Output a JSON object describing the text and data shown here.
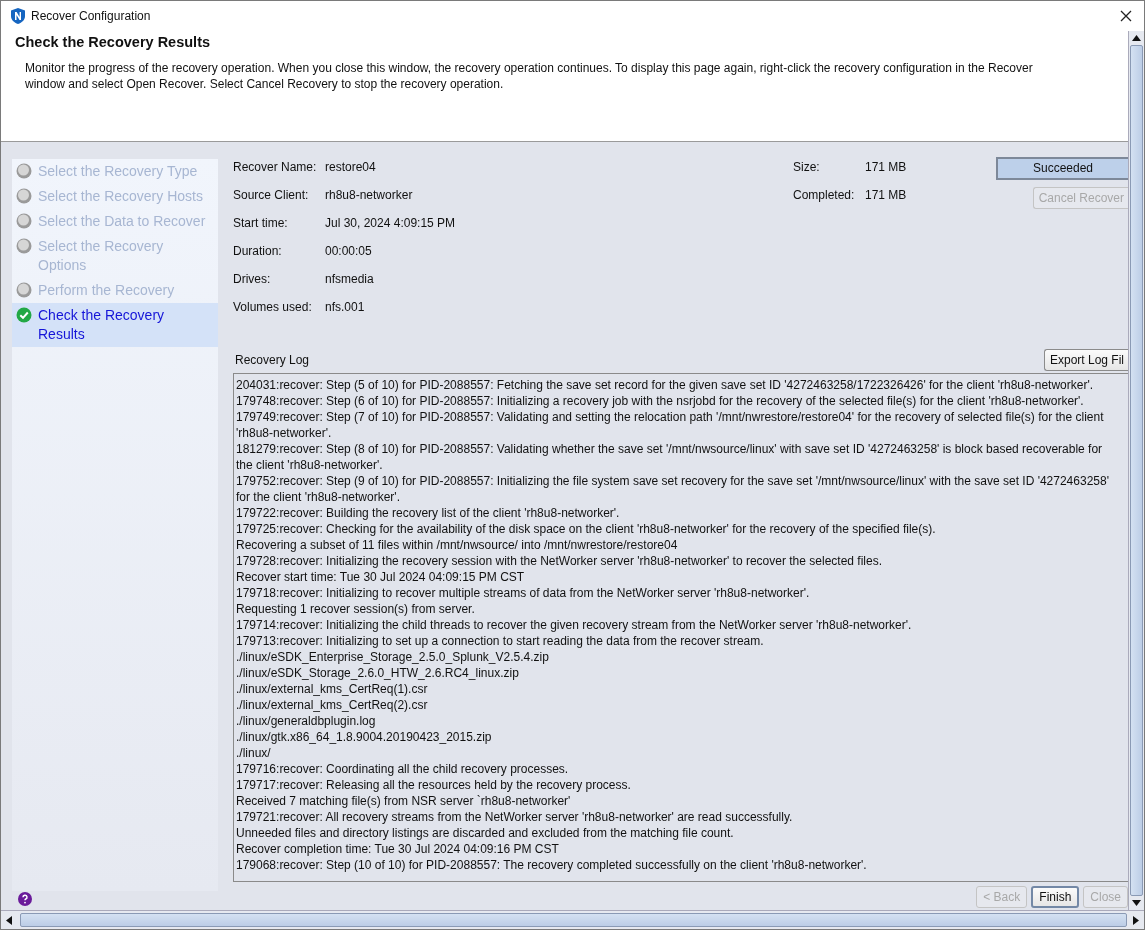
{
  "window": {
    "title": "Recover Configuration"
  },
  "header": {
    "title": "Check the Recovery Results",
    "description": "Monitor the progress of the recovery operation. When you close this window, the recovery operation continues. To display this page again, right-click the recovery configuration in the Recover window and select Open Recover. Select Cancel Recovery to stop the recovery operation."
  },
  "steps": [
    {
      "label": "Select the Recovery Type",
      "selected": false
    },
    {
      "label": "Select the Recovery Hosts",
      "selected": false
    },
    {
      "label": "Select the Data to Recover",
      "selected": false
    },
    {
      "label": "Select the Recovery Options",
      "selected": false
    },
    {
      "label": "Perform the Recovery",
      "selected": false
    },
    {
      "label": "Check the Recovery Results",
      "selected": true
    }
  ],
  "details": [
    {
      "label": "Recover Name:",
      "value": "restore04"
    },
    {
      "label": "Source Client:",
      "value": "rh8u8-networker"
    },
    {
      "label": "Start time:",
      "value": "Jul 30, 2024 4:09:15 PM"
    },
    {
      "label": "Duration:",
      "value": "00:00:05"
    },
    {
      "label": "Drives:",
      "value": "nfsmedia"
    },
    {
      "label": "Volumes used:",
      "value": "nfs.001"
    }
  ],
  "progress": [
    {
      "label": "Size:",
      "value": "171 MB"
    },
    {
      "label": "Completed:",
      "value": "171 MB"
    }
  ],
  "status": "Succeeded",
  "cancel_button": {
    "label": "Cancel Recover",
    "disabled": true
  },
  "log": {
    "title": "Recovery Log",
    "export_button": "Export Log Fil",
    "lines": [
      "204031:recover: Step (5 of 10) for PID-2088557: Fetching the save set record for the given save set ID '4272463258/1722326426' for the client 'rh8u8-networker'.",
      "179748:recover: Step (6 of 10) for PID-2088557: Initializing a recovery job with the nsrjobd for the recovery of the selected file(s) for the client 'rh8u8-networker'.",
      "179749:recover: Step (7 of 10) for PID-2088557: Validating and setting the relocation path '/mnt/nwrestore/restore04' for the recovery of selected file(s) for the client 'rh8u8-networker'.",
      "181279:recover: Step (8 of 10) for PID-2088557: Validating whether the save set '/mnt/nwsource/linux' with save set ID '4272463258' is block based recoverable for the client 'rh8u8-networker'.",
      "179752:recover: Step (9 of 10) for PID-2088557: Initializing the file system save set recovery for the save set '/mnt/nwsource/linux' with the save set ID '4272463258' for the client 'rh8u8-networker'.",
      "179722:recover: Building the recovery list of the client 'rh8u8-networker'.",
      "179725:recover: Checking for the availability of the disk space on the client 'rh8u8-networker' for the recovery of the specified file(s).",
      "Recovering a subset of 11 files within /mnt/nwsource/ into /mnt/nwrestore/restore04",
      "179728:recover: Initializing the recovery session with the NetWorker server 'rh8u8-networker' to recover the selected files.",
      "Recover start time: Tue 30 Jul 2024 04:09:15 PM CST",
      "179718:recover: Initializing to recover multiple streams of data from the NetWorker server 'rh8u8-networker'.",
      "Requesting 1 recover session(s) from server.",
      "179714:recover: Initializing the child threads to recover the given recovery stream from the NetWorker server 'rh8u8-networker'.",
      "179713:recover: Initializing to set up a connection to start reading the data from the recover stream.",
      "./linux/eSDK_Enterprise_Storage_2.5.0_Splunk_V2.5.4.zip",
      "./linux/eSDK_Storage_2.6.0_HTW_2.6.RC4_linux.zip",
      "./linux/external_kms_CertReq(1).csr",
      "./linux/external_kms_CertReq(2).csr",
      "./linux/generaldbplugin.log",
      "./linux/gtk.x86_64_1.8.9004.20190423_2015.zip",
      "./linux/",
      "179716:recover: Coordinating all the child recovery processes.",
      "179717:recover: Releasing all the resources held by the recovery process.",
      "Received 7 matching file(s) from NSR server `rh8u8-networker'",
      "179721:recover: All recovery streams from the NetWorker server 'rh8u8-networker' are read successfully.",
      "Unneeded files and directory listings are discarded and excluded from the matching file count.",
      "Recover completion time: Tue 30 Jul 2024 04:09:16 PM CST",
      "179068:recover: Step (10 of 10) for PID-2088557: The recovery completed successfully on the client 'rh8u8-networker'."
    ]
  },
  "footer_buttons": [
    {
      "label": "< Back",
      "disabled": true
    },
    {
      "label": "Finish",
      "disabled": false
    },
    {
      "label": "Close",
      "disabled": true
    }
  ]
}
